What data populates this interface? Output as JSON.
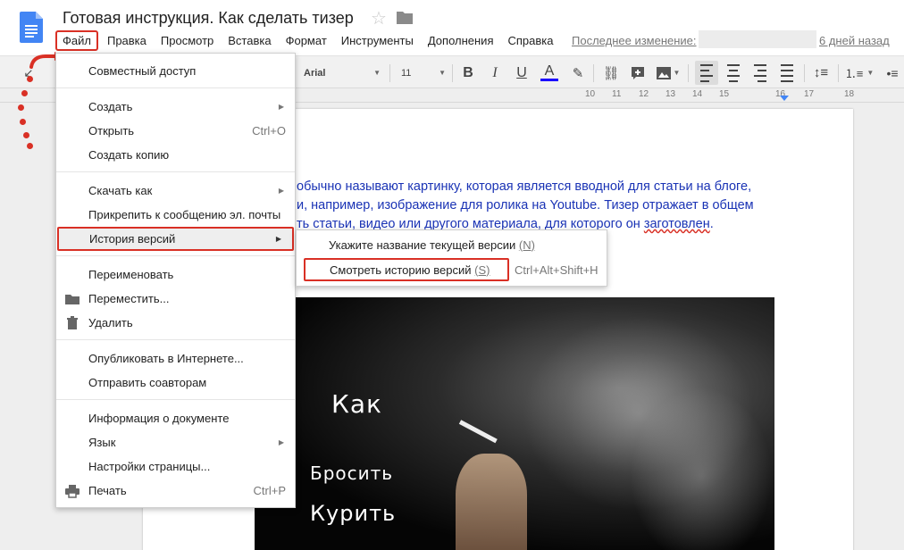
{
  "doc": {
    "title": "Готовая инструкция. Как сделать тизер",
    "last_edit_label": "Последнее изменение:",
    "last_edit_ago": "6 дней назад"
  },
  "menubar": [
    "Файл",
    "Правка",
    "Просмотр",
    "Вставка",
    "Формат",
    "Инструменты",
    "Дополнения",
    "Справка"
  ],
  "toolbar": {
    "font": "Arial",
    "size": "11",
    "bold": "B",
    "italic": "I",
    "underline": "U",
    "text_color": "A"
  },
  "ruler": [
    "10",
    "11",
    "12",
    "13",
    "14",
    "15",
    "16",
    "17",
    "18"
  ],
  "file_menu": {
    "share": "Совместный доступ",
    "new": "Создать",
    "open": "Открыть",
    "open_shortcut": "Ctrl+O",
    "make_copy": "Создать копию",
    "download": "Скачать как",
    "email_attach": "Прикрепить к сообщению эл. почты",
    "version_history": "История версий",
    "rename": "Переименовать",
    "move": "Переместить...",
    "delete": "Удалить",
    "publish": "Опубликовать в Интернете...",
    "email_collaborators": "Отправить соавторам",
    "doc_details": "Информация о документе",
    "language": "Язык",
    "page_setup": "Настройки страницы...",
    "print": "Печать",
    "print_shortcut": "Ctrl+P"
  },
  "version_submenu": {
    "name_current": "Укажите название текущей версии",
    "name_current_key": "(N)",
    "see_history": "Смотреть историю версий",
    "see_history_key": "(S)",
    "see_history_shortcut": "Ctrl+Alt+Shift+H"
  },
  "document": {
    "line1": " обычно называют картинку, которая является вводной для статьи на блоге,",
    "line2": "и, например, изображение для ролика на Youtube. Тизер отражает в общем",
    "line3a": "ть статьи, видео или другого материала, для которого он ",
    "line3b": "заготовлен",
    "line3c": "."
  },
  "image_text": {
    "line1": "Как",
    "line2": "Бросить",
    "line3": "Курить"
  },
  "colors": {
    "accent_red": "#d93025",
    "doc_text_blue": "#1a33b5",
    "docs_blue": "#4285f4"
  }
}
